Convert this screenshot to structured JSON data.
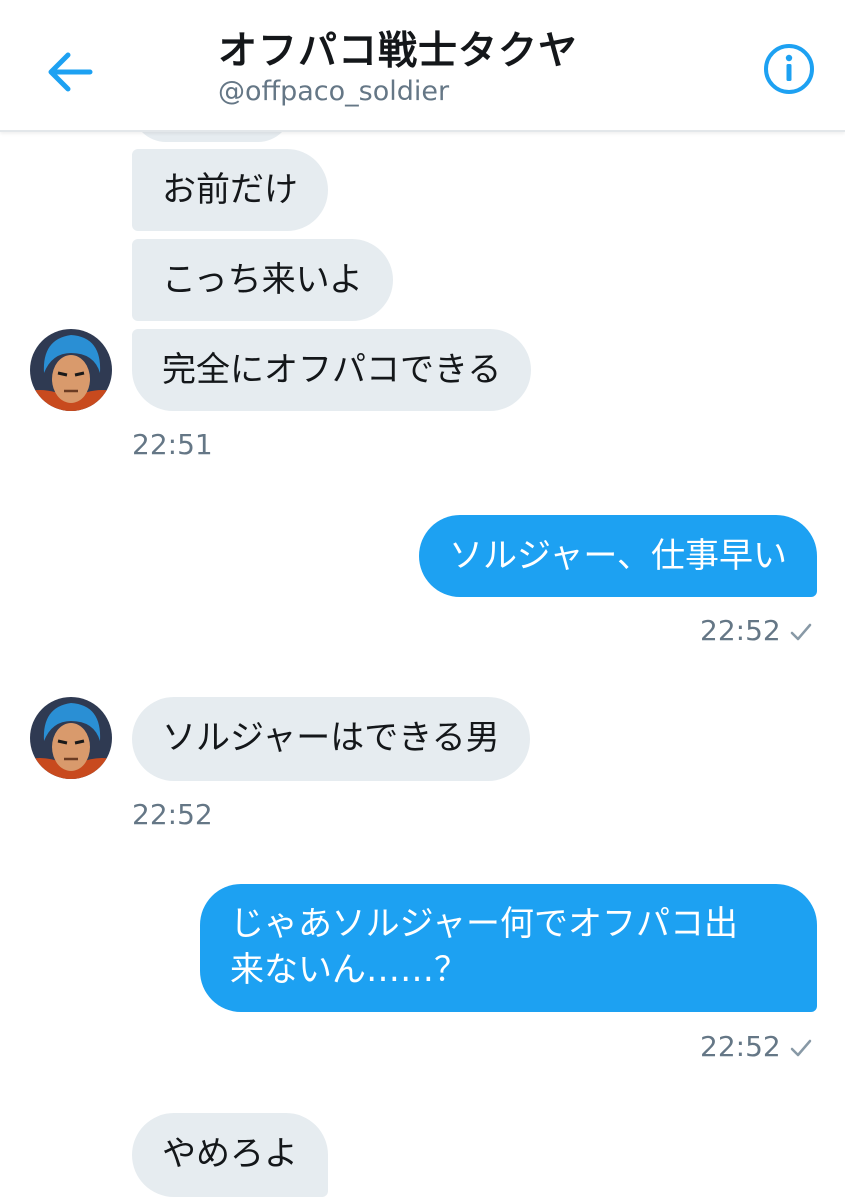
{
  "header": {
    "back_icon": "arrow-left-icon",
    "title": "オフパコ戦士タクヤ",
    "handle": "@offpaco_soldier",
    "info_icon": "info-icon"
  },
  "messages": [
    {
      "text": "お前だけ",
      "from": "other"
    },
    {
      "text": "こっち来いよ",
      "from": "other"
    },
    {
      "text": "完全にオフパコできる",
      "from": "other",
      "time": "22:51"
    },
    {
      "text": "ソルジャー、仕事早い",
      "from": "me",
      "time": "22:52"
    },
    {
      "text": "ソルジャーはできる男",
      "from": "other",
      "time": "22:52"
    },
    {
      "text_line1": "じゃあソルジャー何でオフパコ出",
      "text_line2": "来ないん……？",
      "from": "me",
      "time": "22:52"
    },
    {
      "text": "やめろよ",
      "from": "other"
    }
  ],
  "colors": {
    "accent": "#1da1f2",
    "incoming_bubble": "#e6ecf0",
    "timestamp": "#657786"
  }
}
